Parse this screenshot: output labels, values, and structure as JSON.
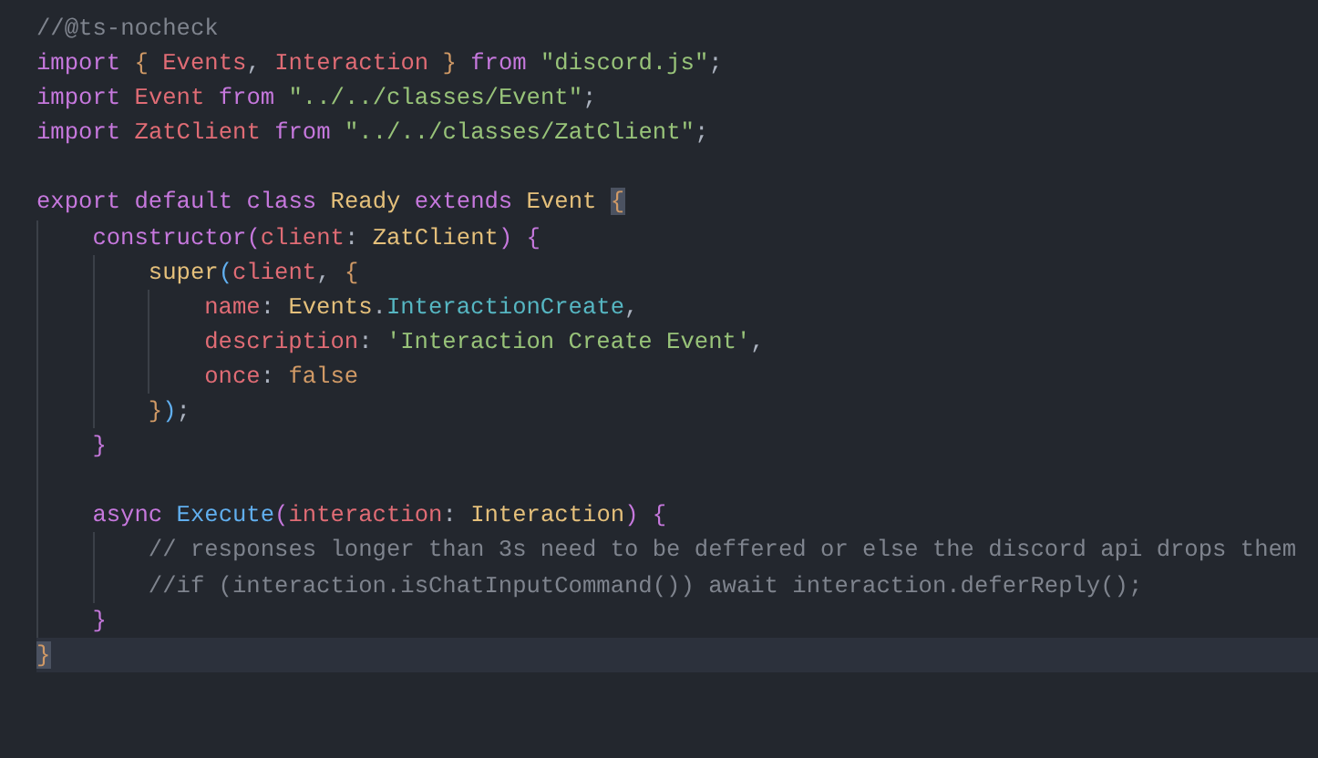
{
  "editor": {
    "lines": [
      {
        "current": false,
        "tokens": [
          {
            "kind": "comment",
            "text": "//@ts-nocheck"
          }
        ]
      },
      {
        "current": false,
        "tokens": [
          {
            "kind": "keyword",
            "text": "import "
          },
          {
            "kind": "bracket1",
            "text": "{"
          },
          {
            "kind": "variable",
            "text": " Events"
          },
          {
            "kind": "plain",
            "text": ", "
          },
          {
            "kind": "variable",
            "text": "Interaction "
          },
          {
            "kind": "bracket1",
            "text": "}"
          },
          {
            "kind": "keyword",
            "text": " from "
          },
          {
            "kind": "string",
            "text": "\"discord.js\""
          },
          {
            "kind": "plain",
            "text": ";"
          }
        ]
      },
      {
        "current": false,
        "tokens": [
          {
            "kind": "keyword",
            "text": "import "
          },
          {
            "kind": "variable",
            "text": "Event "
          },
          {
            "kind": "keyword",
            "text": "from "
          },
          {
            "kind": "string",
            "text": "\"../../classes/Event\""
          },
          {
            "kind": "plain",
            "text": ";"
          }
        ]
      },
      {
        "current": false,
        "tokens": [
          {
            "kind": "keyword",
            "text": "import "
          },
          {
            "kind": "variable",
            "text": "ZatClient "
          },
          {
            "kind": "keyword",
            "text": "from "
          },
          {
            "kind": "string",
            "text": "\"../../classes/ZatClient\""
          },
          {
            "kind": "plain",
            "text": ";"
          }
        ]
      },
      {
        "current": false
      },
      {
        "current": false,
        "tokens": [
          {
            "kind": "keyword",
            "text": "export default class "
          },
          {
            "kind": "class",
            "text": "Ready "
          },
          {
            "kind": "keyword",
            "text": "extends "
          },
          {
            "kind": "class",
            "text": "Event "
          },
          {
            "kind": "bracket1",
            "text": "{",
            "matched": true
          }
        ]
      },
      {
        "current": false,
        "tokens": [
          {
            "kind": "indent"
          },
          {
            "kind": "keyword",
            "text": "constructor"
          },
          {
            "kind": "bracket2",
            "text": "("
          },
          {
            "kind": "variable",
            "text": "client"
          },
          {
            "kind": "plain",
            "text": ": "
          },
          {
            "kind": "class",
            "text": "ZatClient"
          },
          {
            "kind": "bracket2",
            "text": ") {"
          }
        ]
      },
      {
        "current": false,
        "tokens": [
          {
            "kind": "indent"
          },
          {
            "kind": "indent"
          },
          {
            "kind": "class",
            "text": "super"
          },
          {
            "kind": "bracket3",
            "text": "("
          },
          {
            "kind": "variable",
            "text": "client"
          },
          {
            "kind": "plain",
            "text": ", "
          },
          {
            "kind": "bracket1",
            "text": "{"
          }
        ]
      },
      {
        "current": false,
        "tokens": [
          {
            "kind": "indent"
          },
          {
            "kind": "indent"
          },
          {
            "kind": "indent"
          },
          {
            "kind": "variable",
            "text": "name"
          },
          {
            "kind": "plain",
            "text": ": "
          },
          {
            "kind": "class",
            "text": "Events"
          },
          {
            "kind": "plain",
            "text": "."
          },
          {
            "kind": "property",
            "text": "InteractionCreate"
          },
          {
            "kind": "plain",
            "text": ","
          }
        ]
      },
      {
        "current": false,
        "tokens": [
          {
            "kind": "indent"
          },
          {
            "kind": "indent"
          },
          {
            "kind": "indent"
          },
          {
            "kind": "variable",
            "text": "description"
          },
          {
            "kind": "plain",
            "text": ": "
          },
          {
            "kind": "string",
            "text": "'Interaction Create Event'"
          },
          {
            "kind": "plain",
            "text": ","
          }
        ]
      },
      {
        "current": false,
        "tokens": [
          {
            "kind": "indent"
          },
          {
            "kind": "indent"
          },
          {
            "kind": "indent"
          },
          {
            "kind": "variable",
            "text": "once"
          },
          {
            "kind": "plain",
            "text": ": "
          },
          {
            "kind": "boolean",
            "text": "false"
          }
        ]
      },
      {
        "current": false,
        "tokens": [
          {
            "kind": "indent"
          },
          {
            "kind": "indent"
          },
          {
            "kind": "bracket1",
            "text": "}"
          },
          {
            "kind": "bracket3",
            "text": ")"
          },
          {
            "kind": "plain",
            "text": ";"
          }
        ]
      },
      {
        "current": false,
        "tokens": [
          {
            "kind": "indent"
          },
          {
            "kind": "bracket2",
            "text": "}"
          }
        ]
      },
      {
        "current": false,
        "tokens": [
          {
            "kind": "indent"
          }
        ]
      },
      {
        "current": false,
        "tokens": [
          {
            "kind": "indent"
          },
          {
            "kind": "keyword",
            "text": "async "
          },
          {
            "kind": "function",
            "text": "Execute"
          },
          {
            "kind": "bracket2",
            "text": "("
          },
          {
            "kind": "variable",
            "text": "interaction"
          },
          {
            "kind": "plain",
            "text": ": "
          },
          {
            "kind": "class",
            "text": "Interaction"
          },
          {
            "kind": "bracket2",
            "text": ") {"
          }
        ]
      },
      {
        "current": false,
        "tokens": [
          {
            "kind": "indent"
          },
          {
            "kind": "indent"
          },
          {
            "kind": "comment",
            "text": "// responses longer than 3s need to be deffered or else the discord api drops them"
          }
        ]
      },
      {
        "current": false,
        "tokens": [
          {
            "kind": "indent"
          },
          {
            "kind": "indent"
          },
          {
            "kind": "comment",
            "text": "//if (interaction.isChatInputCommand()) await interaction.deferReply();"
          }
        ]
      },
      {
        "current": false,
        "tokens": [
          {
            "kind": "indent"
          },
          {
            "kind": "bracket2",
            "text": "}"
          }
        ]
      },
      {
        "current": true,
        "tokens": [
          {
            "kind": "bracket1",
            "text": "}",
            "matched": true
          }
        ]
      }
    ]
  }
}
